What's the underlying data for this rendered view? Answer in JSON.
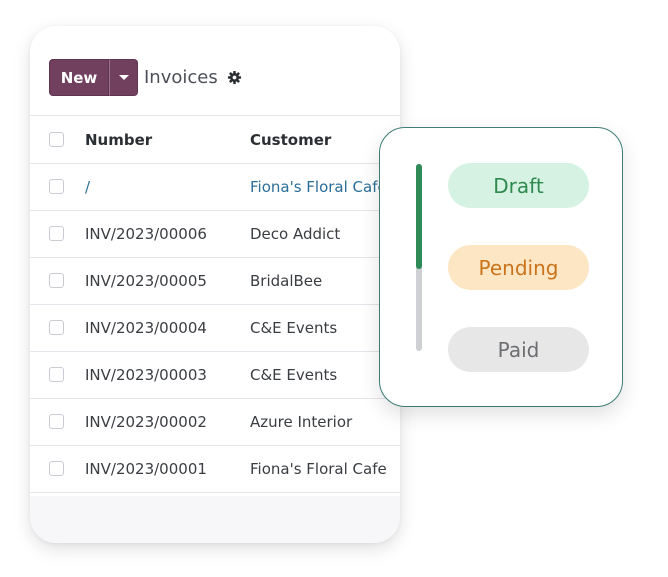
{
  "toolbar": {
    "new_label": "New",
    "title": "Invoices",
    "dropdown_icon": "caret-down-icon",
    "settings_icon": "gear-icon"
  },
  "table": {
    "columns": [
      "Number",
      "Customer"
    ],
    "rows": [
      {
        "number": "/",
        "customer": "Fiona's Floral Cafe"
      },
      {
        "number": "INV/2023/00006",
        "customer": "Deco Addict"
      },
      {
        "number": "INV/2023/00005",
        "customer": "BridalBee"
      },
      {
        "number": "INV/2023/00004",
        "customer": "C&E Events"
      },
      {
        "number": "INV/2023/00003",
        "customer": "C&E Events"
      },
      {
        "number": "INV/2023/00002",
        "customer": "Azure Interior"
      },
      {
        "number": "INV/2023/00001",
        "customer": "Fiona's Floral Cafe"
      }
    ]
  },
  "status": {
    "progress": 0.56,
    "stages": [
      {
        "label": "Draft",
        "color": "#2f8a50",
        "background": "#d6f2e2"
      },
      {
        "label": "Pending",
        "color": "#c9741c",
        "background": "#fde6c4"
      },
      {
        "label": "Paid",
        "color": "#6c6e72",
        "background": "#e7e7e8"
      }
    ],
    "progress_color": "#2e8b57"
  },
  "colors": {
    "brand": "#71405f",
    "link": "#2c6e98",
    "accent_border": "#3d7d74"
  }
}
